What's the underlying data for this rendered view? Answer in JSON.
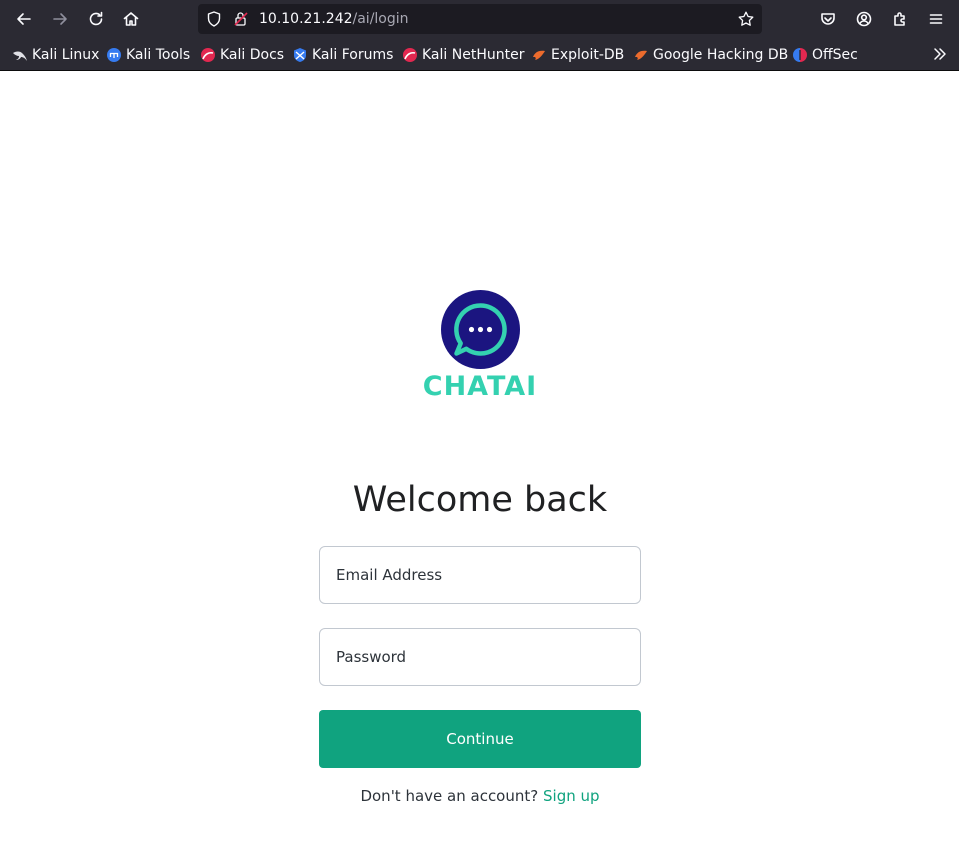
{
  "browser": {
    "url_host": "10.10.21.242",
    "url_path": "/ai/login",
    "bookmarks": [
      {
        "label": "Kali Linux",
        "icon": "kali-dragon-icon"
      },
      {
        "label": "Kali Tools",
        "icon": "kali-tools-icon"
      },
      {
        "label": "Kali Docs",
        "icon": "kali-docs-icon"
      },
      {
        "label": "Kali Forums",
        "icon": "kali-forums-icon"
      },
      {
        "label": "Kali NetHunter",
        "icon": "kali-nethunter-icon"
      },
      {
        "label": "Exploit-DB",
        "icon": "exploit-db-icon"
      },
      {
        "label": "Google Hacking DB",
        "icon": "ghdb-icon"
      },
      {
        "label": "OffSec",
        "icon": "offsec-icon"
      }
    ]
  },
  "page": {
    "logo_text": "CHATAI",
    "heading": "Welcome back",
    "email_placeholder": "Email Address",
    "password_placeholder": "Password",
    "continue_label": "Continue",
    "signup_prompt": "Don't have an account?",
    "signup_link": "Sign up"
  },
  "colors": {
    "accent": "#10a37f",
    "logo_circle": "#1b1580",
    "logo_text": "#34d1b0",
    "chrome_bg": "#2b2a33"
  }
}
